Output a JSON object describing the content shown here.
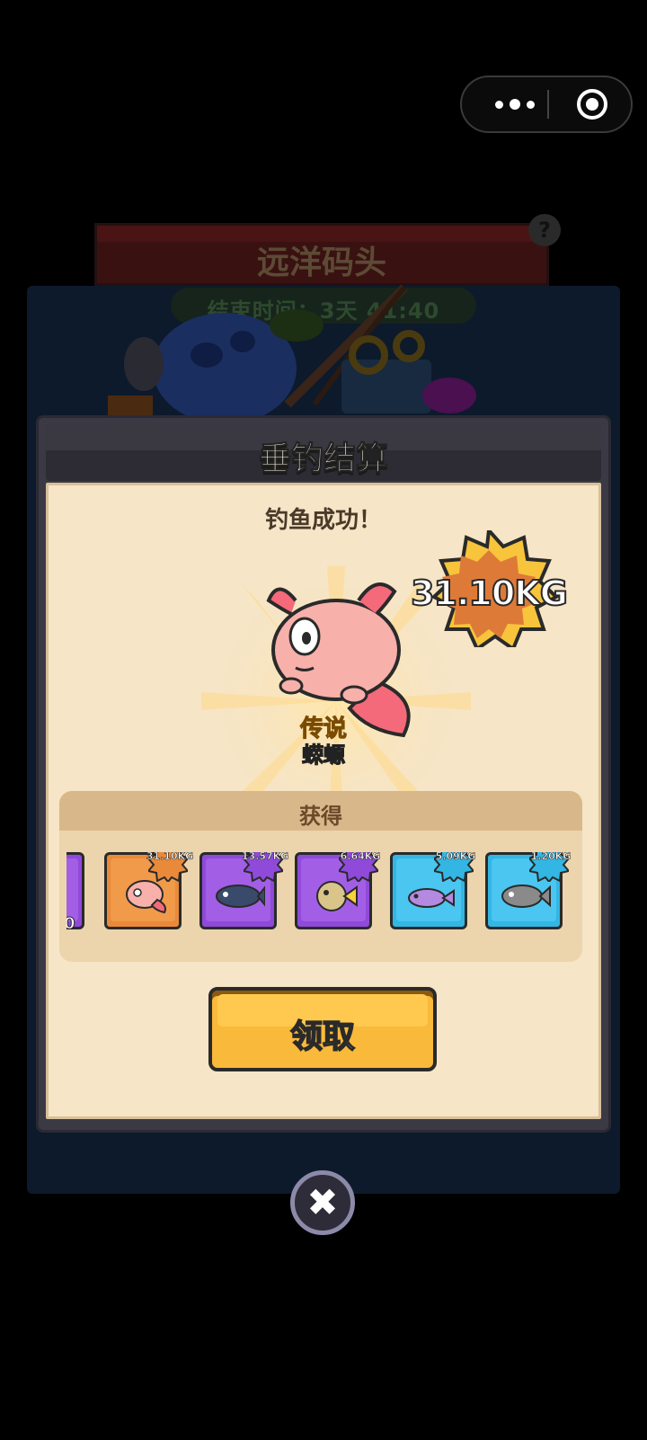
{
  "background": {
    "location_title": "远洋码头",
    "timer_text": "结束时间：3天 41:40",
    "help_icon": "?"
  },
  "capsule": {
    "more_icon": "more-icon",
    "exit_icon": "target-icon"
  },
  "dialog": {
    "title": "垂钓结算",
    "status": "钓鱼成功！",
    "catch": {
      "rarity": "传说",
      "name": "蝾螈",
      "weight": "31.10KG"
    },
    "obtain": {
      "label": "获得",
      "items": [
        {
          "weight": "31.10KG",
          "frame": "orange"
        },
        {
          "weight": "13.57KG",
          "frame": "purple"
        },
        {
          "weight": "6.64KG",
          "frame": "purple"
        },
        {
          "weight": "5.09KG",
          "frame": "blue"
        },
        {
          "weight": "1.20KG",
          "frame": "blue"
        }
      ],
      "partial_item_text": "0"
    },
    "claim_label": "领取",
    "close_icon": "✖"
  },
  "colors": {
    "orange": "#e98a3a",
    "purple": "#8f4ad9",
    "blue": "#33b6e3",
    "button": "#f9b93a"
  }
}
